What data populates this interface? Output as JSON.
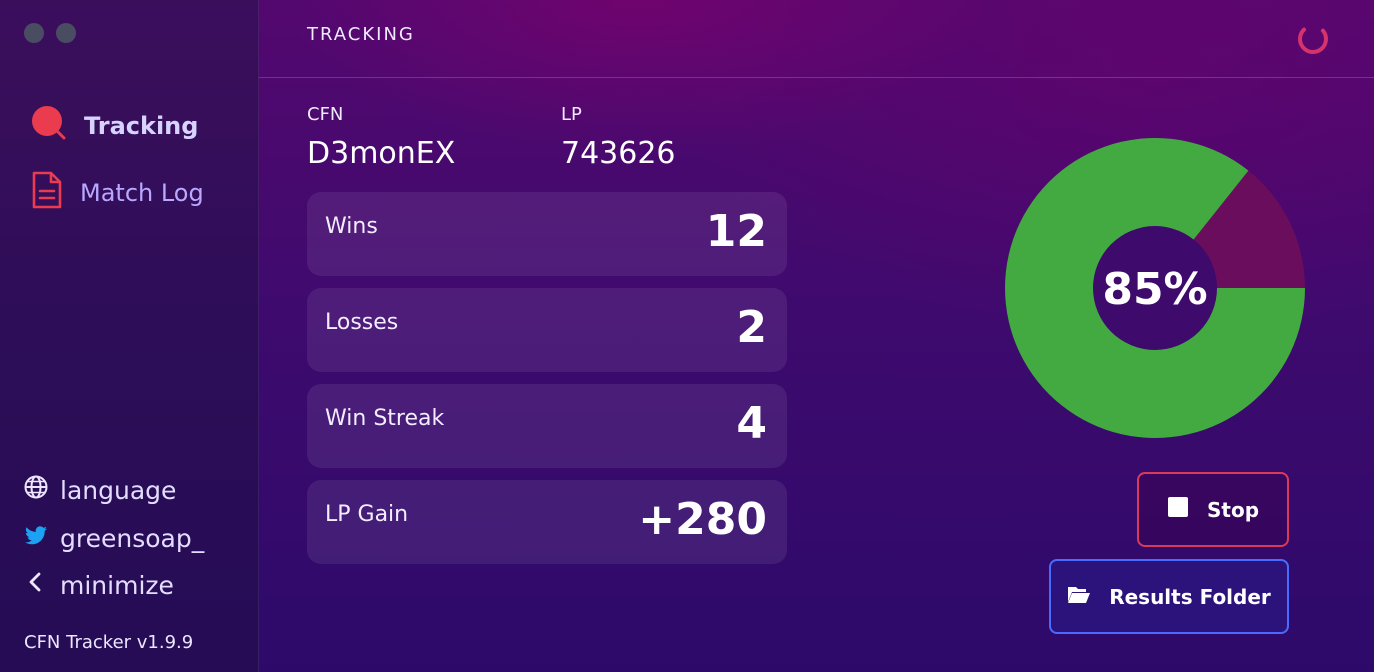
{
  "sidebar": {
    "nav": [
      {
        "label": "Tracking",
        "icon": "search-icon",
        "active": true
      },
      {
        "label": "Match Log",
        "icon": "document-icon",
        "active": false
      }
    ],
    "links": [
      {
        "label": "language",
        "icon": "globe-icon"
      },
      {
        "label": "greensoap_",
        "icon": "twitter-icon"
      },
      {
        "label": "minimize",
        "icon": "chevron-left-icon"
      }
    ],
    "version": "CFN Tracker v1.9.9"
  },
  "header": {
    "title": "TRACKING",
    "spinner_icon": "loading-spinner-icon"
  },
  "player": {
    "cfn_label": "CFN",
    "cfn_value": "D3monEX",
    "lp_label": "LP",
    "lp_value": "743626"
  },
  "stats": [
    {
      "label": "Wins",
      "value": "12"
    },
    {
      "label": "Losses",
      "value": "2"
    },
    {
      "label": "Win Streak",
      "value": "4"
    },
    {
      "label": "LP Gain",
      "value": "+280"
    }
  ],
  "winrate": {
    "percent_text": "85%",
    "win_fraction": 0.857,
    "win_color": "#43aa42",
    "loss_color": "#6b0d5d"
  },
  "actions": {
    "stop_label": "Stop",
    "results_label": "Results Folder"
  },
  "colors": {
    "accent_red": "#ea3b4f",
    "stop_border": "#d83b5a",
    "results_border": "#4a6bff"
  }
}
